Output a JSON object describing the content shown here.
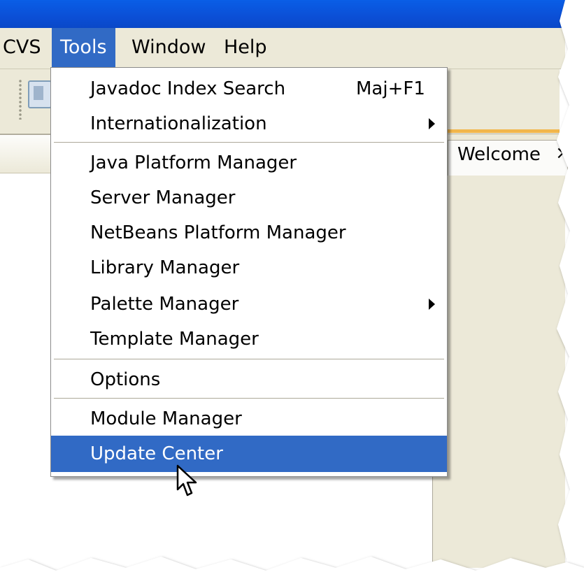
{
  "menubar": {
    "items": [
      {
        "label": "CVS"
      },
      {
        "label": "Tools"
      },
      {
        "label": "Window"
      },
      {
        "label": "Help"
      }
    ]
  },
  "tools_menu": {
    "items": [
      {
        "label": "Javadoc Index Search",
        "shortcut": "Maj+F1"
      },
      {
        "label": "Internationalization",
        "submenu": true
      },
      {
        "label": "Java Platform Manager"
      },
      {
        "label": "Server Manager"
      },
      {
        "label": "NetBeans Platform Manager"
      },
      {
        "label": "Library Manager"
      },
      {
        "label": "Palette Manager",
        "submenu": true
      },
      {
        "label": "Template Manager"
      },
      {
        "label": "Options"
      },
      {
        "label": "Module Manager"
      },
      {
        "label": "Update Center",
        "selected": true
      }
    ]
  },
  "editor": {
    "tab_label": "Welcome",
    "tab_close": "×"
  },
  "colors": {
    "selection": "#316ac5",
    "titlebar": "#0b4fd6",
    "chrome": "#ece9d8"
  }
}
